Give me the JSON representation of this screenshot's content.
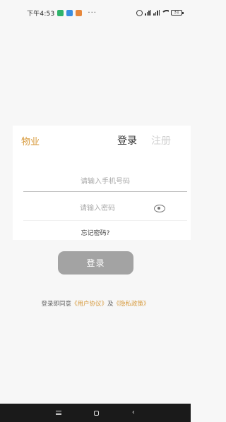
{
  "status_bar": {
    "time": "下午4:53",
    "dots": "···",
    "battery": "31",
    "icons": [
      "app-green-icon",
      "app-blue-icon",
      "app-orange-icon",
      "alarm-icon",
      "signal-icon",
      "signal-icon",
      "wifi-icon",
      "battery-icon"
    ]
  },
  "login": {
    "brand": "物业",
    "tab_login": "登录",
    "tab_register": "注册",
    "phone_placeholder": "请输入手机号码",
    "password_placeholder": "请输入密码",
    "forgot_password": "忘记密码?",
    "login_button": "登录",
    "agreement_prefix": "登录即同意",
    "user_agreement": "《用户协议》",
    "and_text": "及",
    "privacy_policy": "《隐私政策》"
  },
  "colors": {
    "accent": "#d79a3c",
    "button_disabled": "#a3a3a3",
    "background": "#f7f7f7",
    "nav_bar": "#1a1a1a"
  },
  "nav_bar": {
    "icons": [
      "menu-icon",
      "home-icon",
      "back-icon"
    ],
    "back_glyph": "‹"
  }
}
